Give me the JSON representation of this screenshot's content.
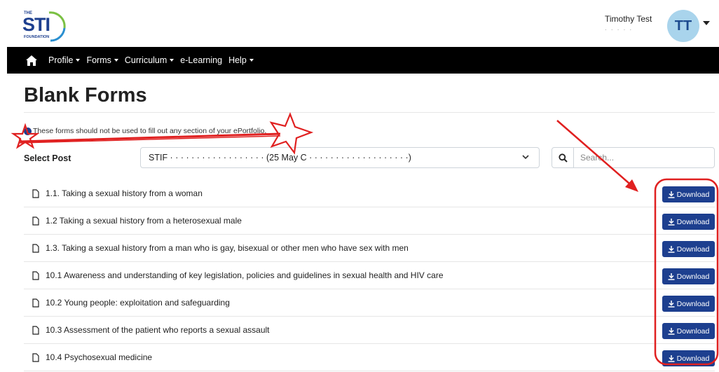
{
  "header": {
    "logo_small": "THE",
    "logo_main": "STI",
    "logo_sub": "FOUNDATION",
    "user_name": "Timothy Test",
    "user_sub": "· · · · ·",
    "avatar_initials": "TT"
  },
  "nav": {
    "items": [
      {
        "label": "Profile",
        "dropdown": true
      },
      {
        "label": "Forms",
        "dropdown": true
      },
      {
        "label": "Curriculum",
        "dropdown": true
      },
      {
        "label": "e-Learning",
        "dropdown": false
      },
      {
        "label": "Help",
        "dropdown": true
      }
    ]
  },
  "page": {
    "title": "Blank Forms",
    "info": "These forms should not be used to fill out any section of your ePortfolio."
  },
  "filters": {
    "select_label": "Select Post",
    "selected_post": "STIF · · · · · · · · · · · · · · · · · · (25 May C · · · · · · · · · · · · · · · · · · ·)",
    "search_placeholder": "Search..."
  },
  "download_label": "Download",
  "forms": [
    "1.1. Taking a sexual history from a woman",
    "1.2 Taking a sexual history from a heterosexual male",
    "1.3. Taking a sexual history from a man who is gay, bisexual or other men who have sex with men",
    "10.1 Awareness and understanding of key legislation, policies and guidelines in sexual health and HIV care",
    "10.2 Young people: exploitation and safeguarding",
    "10.3 Assessment of the patient who reports a sexual assault",
    "10.4 Psychosexual medicine"
  ],
  "colors": {
    "brand_blue": "#1d3f8f",
    "nav_bg": "#000000",
    "avatar_bg": "#a9d4ec",
    "annotation_red": "#e02020"
  }
}
